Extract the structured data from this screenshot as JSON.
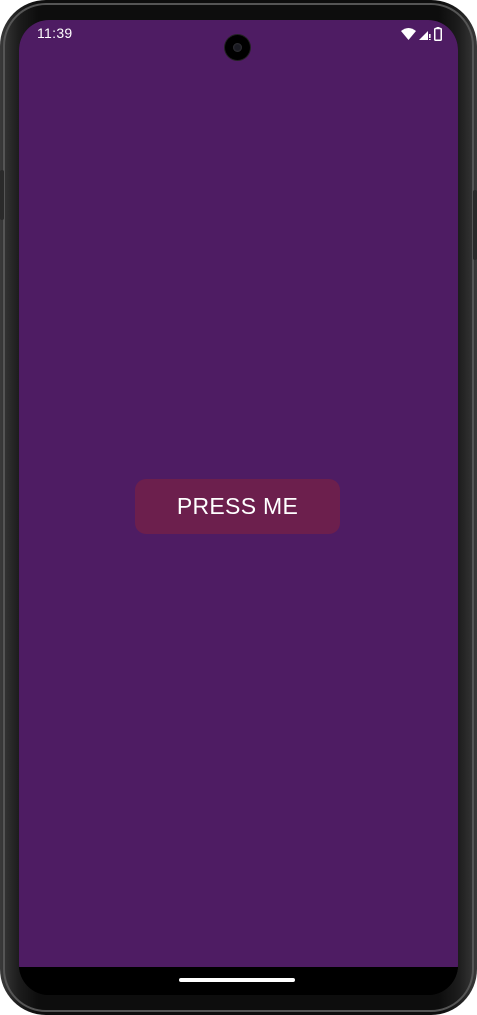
{
  "status_bar": {
    "time": "11:39",
    "icons": [
      "wifi-icon",
      "signal-icon",
      "battery-icon"
    ]
  },
  "main": {
    "button_label": "PRESS ME"
  },
  "colors": {
    "background": "#4e1c63",
    "button": "#6c1f4d",
    "button_text": "#ffffff"
  }
}
